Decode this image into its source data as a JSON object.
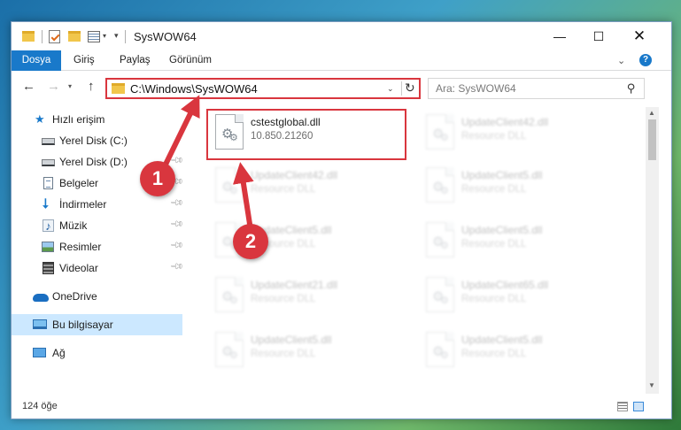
{
  "window": {
    "title": "SysWOW64",
    "minimize": "—",
    "maximize": "☐",
    "close": "✕"
  },
  "ribbon": {
    "tabs": [
      "Dosya",
      "Giriş",
      "Paylaş",
      "Görünüm"
    ],
    "help": "?"
  },
  "nav": {
    "address": "C:\\Windows\\SysWOW64",
    "search_placeholder": "Ara: SysWOW64"
  },
  "sidebar": {
    "items": [
      {
        "label": "Hızlı erişim",
        "icon": "star-icon"
      },
      {
        "label": "Yerel Disk (C:)",
        "icon": "drive-icon"
      },
      {
        "label": "Yerel Disk (D:)",
        "icon": "drive-icon"
      },
      {
        "label": "Belgeler",
        "icon": "documents-icon"
      },
      {
        "label": "İndirmeler",
        "icon": "download-icon"
      },
      {
        "label": "Müzik",
        "icon": "music-icon"
      },
      {
        "label": "Resimler",
        "icon": "pictures-icon"
      },
      {
        "label": "Videolar",
        "icon": "videos-icon"
      },
      {
        "label": "OneDrive",
        "icon": "cloud-icon"
      },
      {
        "label": "Bu bilgisayar",
        "icon": "computer-icon"
      },
      {
        "label": "Ağ",
        "icon": "network-icon"
      }
    ]
  },
  "files": [
    {
      "name": "cstestglobal.dll",
      "desc": "10.850.21260"
    },
    {
      "name": "UpdateClient42.dll",
      "desc": "Resource DLL"
    },
    {
      "name": "UpdateClient42.dll",
      "desc": "Resource DLL"
    },
    {
      "name": "UpdateClient5.dll",
      "desc": "Resource DLL"
    },
    {
      "name": "UpdateClient5.dll",
      "desc": "Resource DLL"
    },
    {
      "name": "UpdateClient5.dll",
      "desc": "Resource DLL"
    },
    {
      "name": "UpdateClient21.dll",
      "desc": "Resource DLL"
    },
    {
      "name": "UpdateClient65.dll",
      "desc": "Resource DLL"
    },
    {
      "name": "UpdateClient5.dll",
      "desc": "Resource DLL"
    },
    {
      "name": "UpdateClient5.dll",
      "desc": "Resource DLL"
    }
  ],
  "status": {
    "count": "124 öğe"
  },
  "annotations": {
    "badge1": "1",
    "badge2": "2",
    "color": "#d9363e"
  }
}
